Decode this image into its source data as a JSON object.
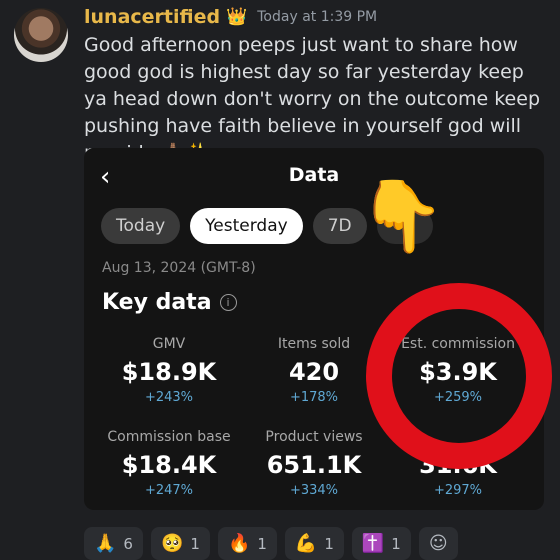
{
  "header": {
    "username": "lunacertified",
    "badge_emoji": "👑",
    "timestamp": "Today at 1:39 PM"
  },
  "message": {
    "text": "Good afternoon peeps just want to share how good god is highest day so far yesterday keep ya head down don't worry on the outcome keep pushing have faith believe in yourself god will provide 🙏🏽✨"
  },
  "card": {
    "back_icon": "‹",
    "title": "Data",
    "tabs": [
      {
        "label": "Today"
      },
      {
        "label": "Yesterday",
        "active": true
      },
      {
        "label": "7D"
      },
      {
        "label": ""
      }
    ],
    "date": "Aug 13, 2024 (GMT-8)",
    "section_title": "Key data",
    "info_glyph": "i",
    "metrics": [
      {
        "label": "GMV",
        "value": "$18.9K",
        "change": "+243%"
      },
      {
        "label": "Items sold",
        "value": "420",
        "change": "+178%"
      },
      {
        "label": "Est. commission",
        "value": "$3.9K",
        "change": "+259%"
      },
      {
        "label": "Commission base",
        "value": "$18.4K",
        "change": "+247%"
      },
      {
        "label": "Product views",
        "value": "651.1K",
        "change": "+334%"
      },
      {
        "label": "",
        "value": "31.6K",
        "change": "+297%"
      }
    ]
  },
  "overlay": {
    "pointer_emoji": "👇",
    "circle_color": "#e0101a"
  },
  "reactions": [
    {
      "emoji": "🙏",
      "count": "6"
    },
    {
      "emoji": "🥺",
      "count": "1"
    },
    {
      "emoji": "🔥",
      "count": "1"
    },
    {
      "emoji": "💪",
      "count": "1"
    },
    {
      "emoji": "✝️",
      "count": "1"
    },
    {
      "emoji": "☺",
      "count": ""
    }
  ],
  "colors": {
    "username": "#e8b84a",
    "accent_change": "#5fa8d3",
    "background": "#1e1f22"
  }
}
